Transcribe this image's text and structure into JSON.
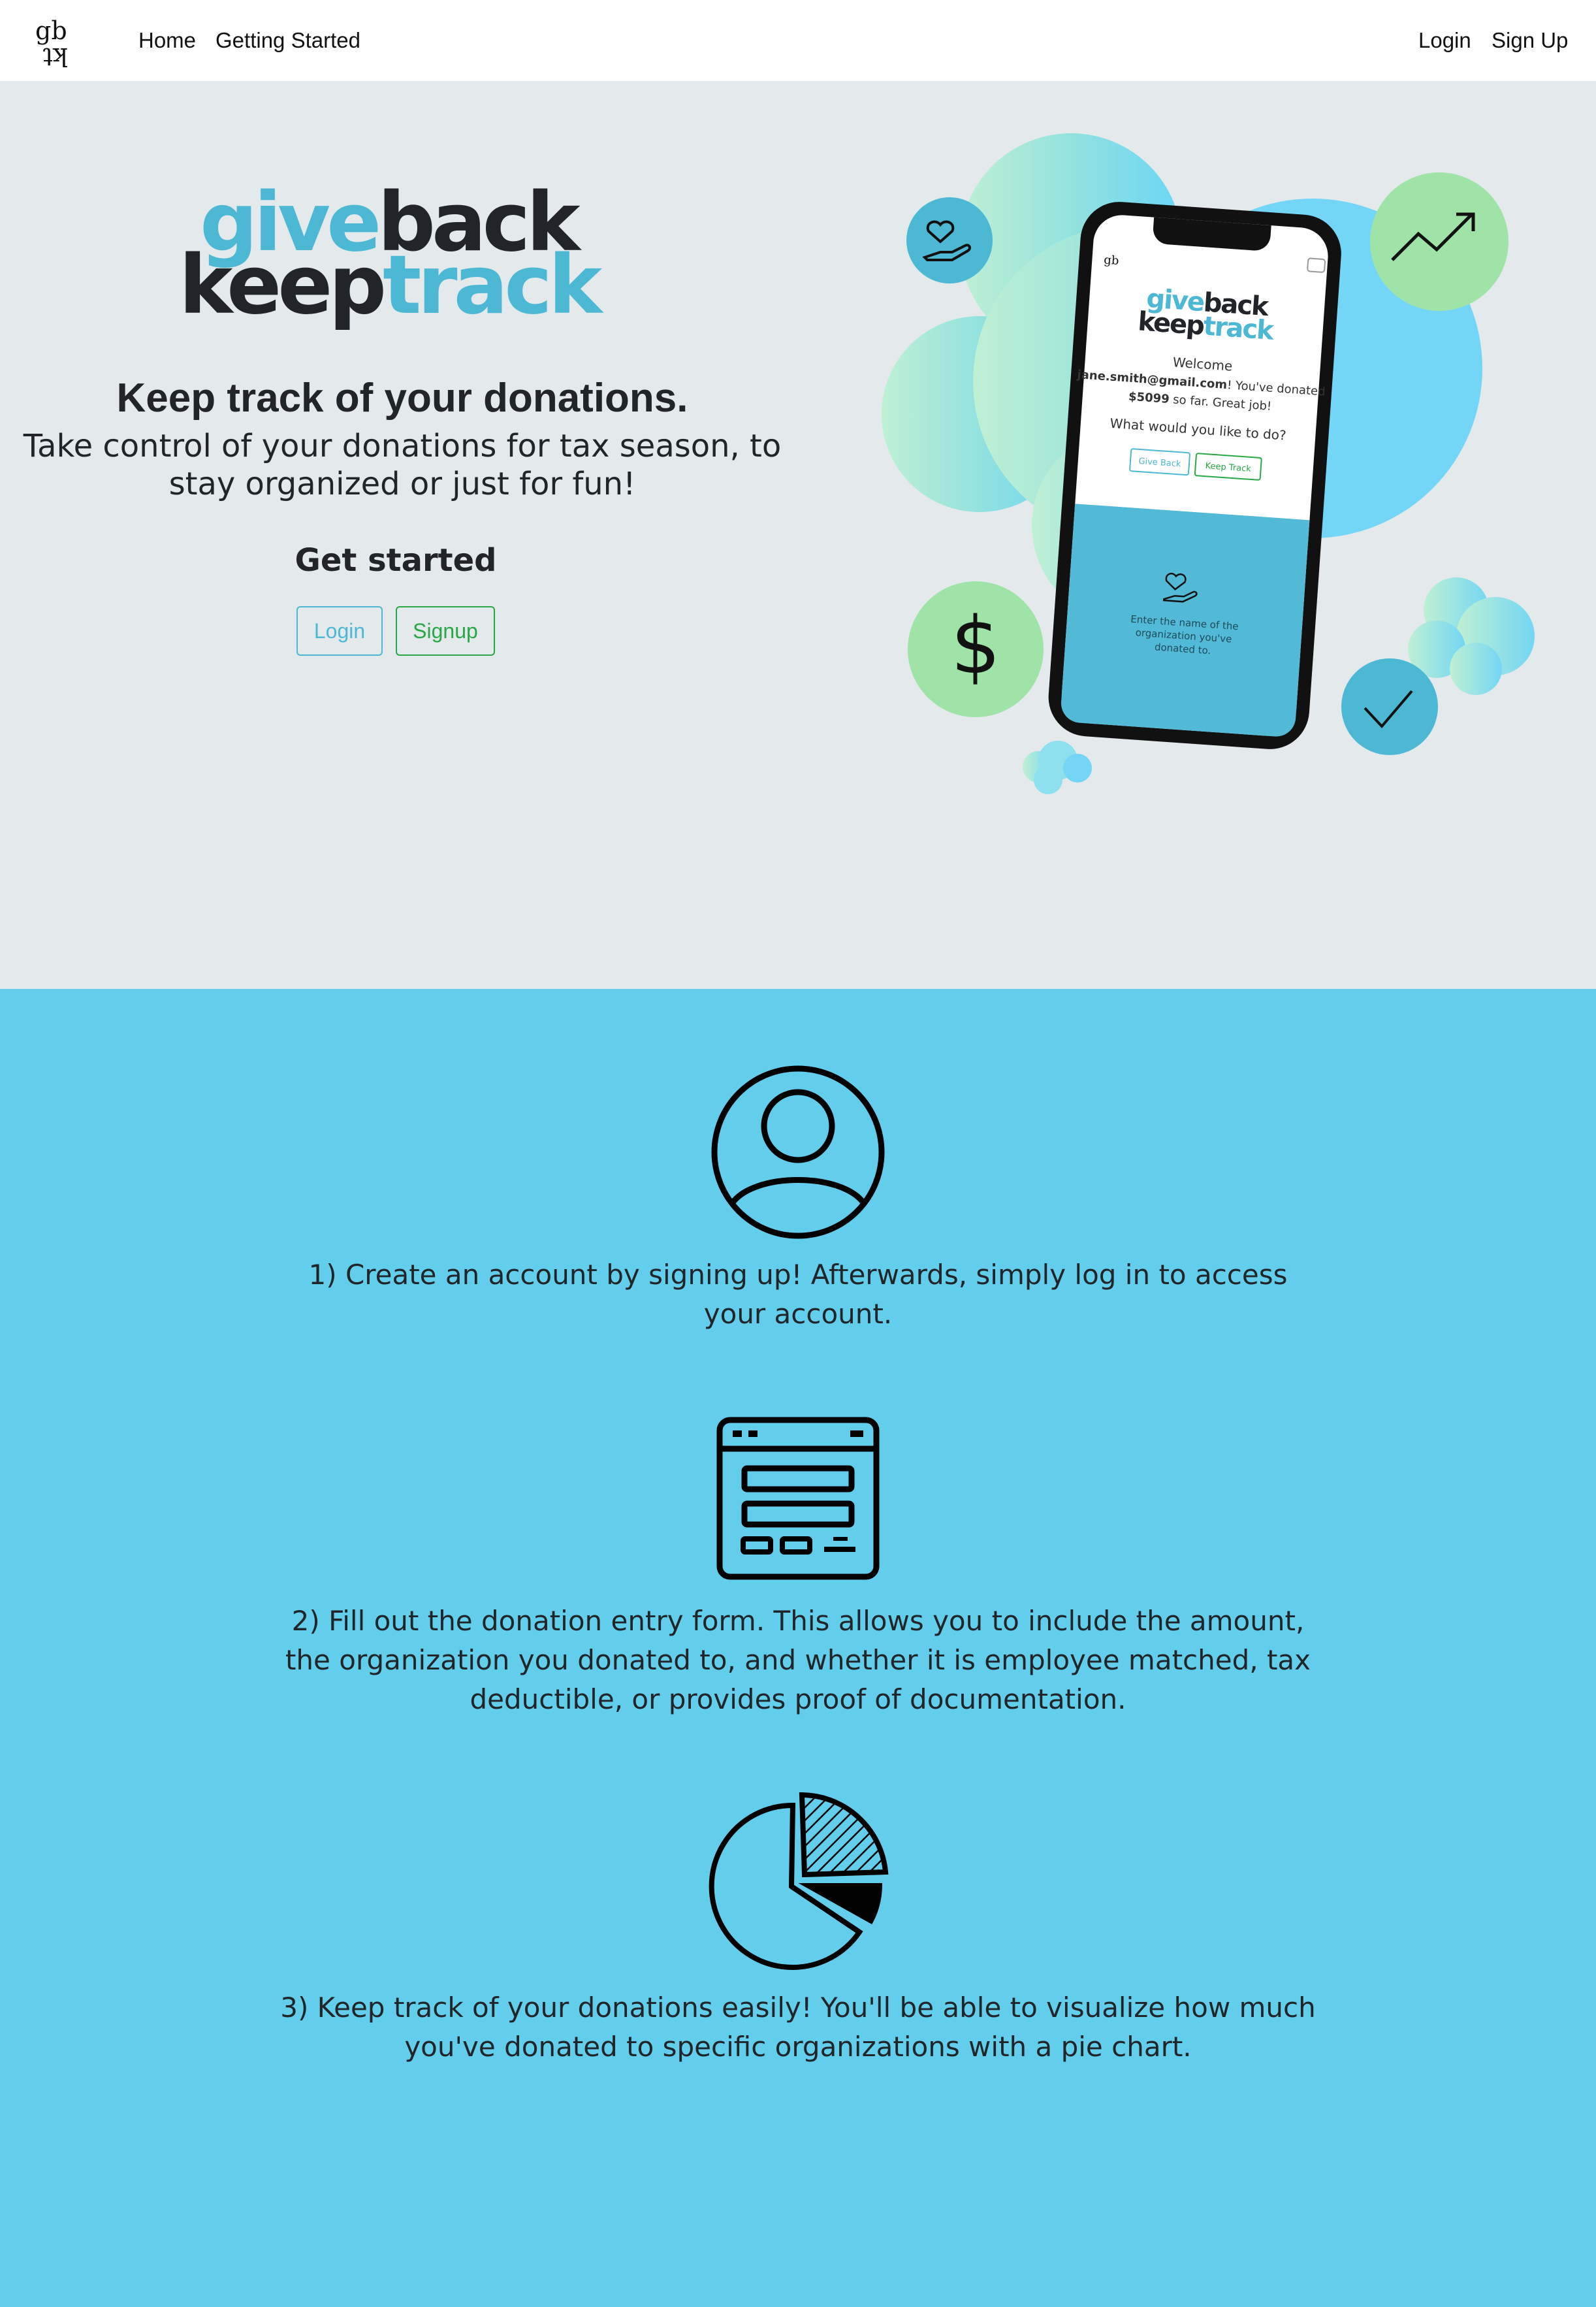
{
  "navbar": {
    "brand_icon": "gb-kt-monogram-logo",
    "links": [
      "Home",
      "Getting Started"
    ],
    "auth_links": [
      "Login",
      "Sign Up"
    ]
  },
  "hero": {
    "wordmark": {
      "give": "give",
      "back": "back",
      "keep": "keep",
      "track": "track"
    },
    "heading": "Keep track of your donations.",
    "subheading": "Take control of your donations for tax season, to stay organized or just for fun!",
    "get_started": "Get started",
    "buttons": {
      "login": "Login",
      "signup": "Signup"
    },
    "phone_screen": {
      "wordmark": {
        "give": "give",
        "back": "back",
        "keep": "keep",
        "track": "track"
      },
      "welcome": "Welcome",
      "email": "jane.smith@gmail.com",
      "donated_prefix": "! You've donated ",
      "amount": "$5099",
      "donated_suffix": " so far. Great job!",
      "question": "What would you like to do?",
      "buttons": [
        "Give Back",
        "Keep Track"
      ],
      "bottom_text": "Enter the name of the organization you've donated to."
    },
    "icons": [
      "heart-in-hand-icon",
      "trend-up-arrow-icon",
      "dollar-sign-icon",
      "checkmark-icon"
    ]
  },
  "steps": [
    {
      "icon": "user-account-icon",
      "text": "1) Create an account by signing up! Afterwards, simply log in to access your account."
    },
    {
      "icon": "form-window-icon",
      "text": "2) Fill out the donation entry form. This allows you to include the amount, the organization you donated to, and whether it is employee matched, tax deductible, or provides proof of documentation."
    },
    {
      "icon": "pie-chart-icon",
      "text": "3) Keep track of your donations easily! You'll be able to visualize how much you've donated to specific organizations with a pie chart."
    }
  ],
  "colors": {
    "accent_blue": "#4cb8d4",
    "accent_green": "#28a745",
    "hero_bg": "#e4eaec",
    "steps_bg": "#63cdec",
    "text_dark": "#212529"
  }
}
